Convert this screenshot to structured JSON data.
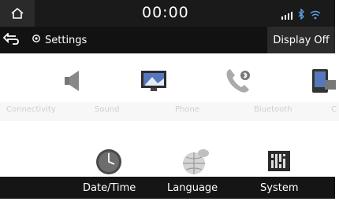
{
  "status": {
    "time": "00:00",
    "icons": [
      "signal-icon",
      "bluetooth-icon",
      "wifi-icon"
    ]
  },
  "header": {
    "title": "Settings",
    "display_off_label": "Display Off"
  },
  "categories": [
    {
      "label": "Connectivity",
      "icon": "speaker-icon"
    },
    {
      "label": "Sound",
      "icon": "display-icon"
    },
    {
      "label": "Phone",
      "icon": "phone-bluetooth-icon"
    },
    {
      "label": "Bluetooth",
      "icon": "device-icon"
    },
    {
      "label": "C",
      "icon": "more-icon"
    }
  ],
  "menu": [
    {
      "label": "Date/Time",
      "icon": "clock-icon"
    },
    {
      "label": "Language",
      "icon": "globe-icon"
    },
    {
      "label": "System",
      "icon": "system-icon"
    }
  ],
  "colors": {
    "status_bar": "#1a1a1a",
    "title_bar": "#121212",
    "button_bg": "#2b2b2b",
    "bottom_bar": "#151515",
    "accent": "#5aa0e8"
  }
}
